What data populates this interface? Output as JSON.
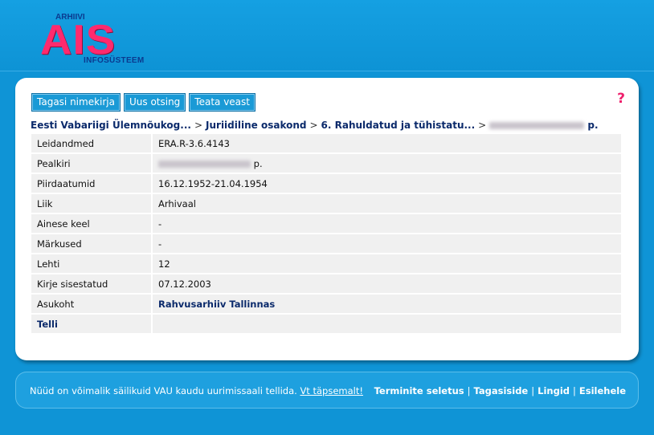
{
  "logo": {
    "top_word": "ARHIIVI",
    "main_word": "AIS",
    "bottom_word": "INFOSÜSTEEM",
    "brand_color": "#ff2a6e"
  },
  "toolbar": {
    "back_label": "Tagasi nimekirja",
    "new_search_label": "Uus otsing",
    "report_error_label": "Teata veast",
    "help_icon": "question-mark-icon",
    "help_symbol": "?"
  },
  "breadcrumb": {
    "items": [
      "Eesti Vabariigi Ülemnõukog...",
      "Juriidiline osakond",
      "6. Rahuldatud ja tühistatu..."
    ],
    "separator": ">",
    "last_visible_suffix": "p."
  },
  "details": {
    "rows": [
      {
        "label": "Leidandmed",
        "value": "ERA.R-3.6.4143"
      },
      {
        "label": "Pealkiri",
        "value": "p."
      },
      {
        "label": "Piirdaatumid",
        "value": "16.12.1952-21.04.1954"
      },
      {
        "label": "Liik",
        "value": "Arhivaal"
      },
      {
        "label": "Ainese keel",
        "value": "-"
      },
      {
        "label": "Märkused",
        "value": "-"
      },
      {
        "label": "Lehti",
        "value": "12"
      },
      {
        "label": "Kirje sisestatud",
        "value": "07.12.2003"
      },
      {
        "label": "Asukoht",
        "value": "Rahvusarhiiv Tallinnas"
      }
    ],
    "order_label": "Telli"
  },
  "footer": {
    "notice": "Nüüd on võimalik säilikuid VAU kaudu uurimissaali tellida.",
    "notice_link": "Vt täpsemalt!",
    "links": [
      "Terminite seletus",
      "Tagasiside",
      "Lingid",
      "Esilehele"
    ],
    "link_separator": "|"
  }
}
